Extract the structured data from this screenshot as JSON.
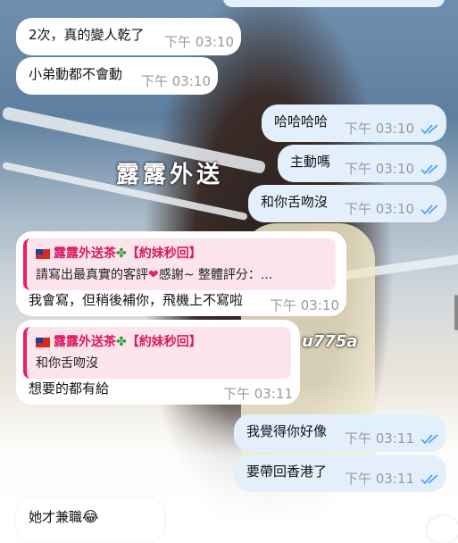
{
  "background": {
    "watermark_main": "露露外送",
    "watermark_partial": "u775a"
  },
  "messages": [
    {
      "dir": "in",
      "text": "2次，真的變人乾了",
      "time": "下午 03:10"
    },
    {
      "dir": "in",
      "text": "小弟動都不會動",
      "time": "下午 03:10"
    },
    {
      "dir": "out",
      "text": "哈哈哈哈",
      "time": "下午 03:10",
      "read": true
    },
    {
      "dir": "out",
      "text": "主動嗎",
      "time": "下午 03:10",
      "read": true
    },
    {
      "dir": "out",
      "text": "和你舌吻沒",
      "time": "下午 03:10",
      "read": true
    },
    {
      "dir": "in",
      "reply_to": {
        "name": "露露外送茶",
        "tag": "【約妹秒回】",
        "text_before": "請寫出最真實的客評",
        "text_after": "感謝~ 整體評分：..."
      },
      "text": "我會寫，但稍後補你，飛機上不寫啦",
      "time": "下午 03:10"
    },
    {
      "dir": "in",
      "reply_to": {
        "name": "露露外送茶",
        "tag": "【約妹秒回】",
        "text_before": "和你舌吻沒",
        "text_after": ""
      },
      "text": "想要的都有給",
      "time": "下午 03:11"
    },
    {
      "dir": "out",
      "text": "我覺得你好像",
      "time": "下午 03:11",
      "read": true
    },
    {
      "dir": "out",
      "text": "要帶回香港了",
      "time": "下午 03:11",
      "read": true
    },
    {
      "dir": "in",
      "text": "她才兼職",
      "time": ""
    }
  ],
  "colors": {
    "incoming_bubble": "#ffffff",
    "outgoing_bubble": "#e3f0fc",
    "read_ticks": "#4ea4f6",
    "quote_accent": "#e91e63",
    "time_text": "#9a9a9a"
  },
  "icons": {
    "flag": "taiwan-flag-icon",
    "clover": "four-leaf-clover-icon",
    "heart": "heart-icon",
    "laugh": "tears-of-joy-icon",
    "read": "double-check-icon"
  }
}
